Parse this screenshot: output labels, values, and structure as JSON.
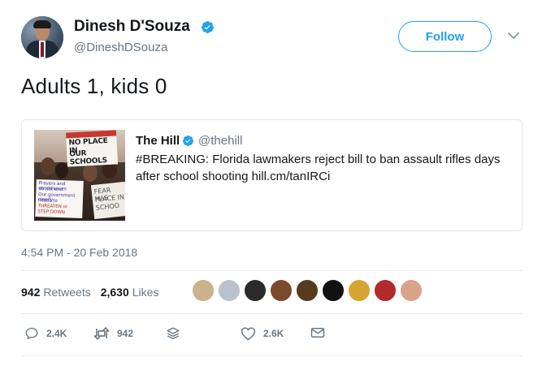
{
  "author": {
    "name": "Dinesh D'Souza",
    "handle": "@DineshDSouza",
    "verified": true
  },
  "follow_label": "Follow",
  "tweet_text": "Adults 1, kids 0",
  "quoted_tweet": {
    "name": "The Hill",
    "handle": "@thehill",
    "verified": true,
    "text": "#BREAKING: Florida lawmakers reject bill to ban assault rifles days after school shooting hill.cm/tanIRCi",
    "image_sign_lines": [
      "NO PLACE IN",
      "OUR SCHOOLS"
    ],
    "image_sign2_lines": [
      "Prayers and condolences",
      "do not end",
      "Our government clearly",
      "needs to",
      "THREATEN or",
      "STEP DOWN"
    ],
    "image_sign3_lines": [
      "FEAR HAS",
      "PLACE IN",
      "SCHOO"
    ]
  },
  "timestamp": "4:54 PM - 20 Feb 2018",
  "stats": {
    "retweets_count": "942",
    "retweets_label": "Retweets",
    "likes_count": "2,630",
    "likes_label": "Likes"
  },
  "likers": [
    {
      "name": "liker-1",
      "color": "#c9b28c"
    },
    {
      "name": "liker-2",
      "color": "#b9c2cc"
    },
    {
      "name": "liker-3",
      "color": "#2a2a2a"
    },
    {
      "name": "liker-4",
      "color": "#7b4a2a"
    },
    {
      "name": "liker-5",
      "color": "#5a3a1e"
    },
    {
      "name": "liker-6",
      "color": "#111111"
    },
    {
      "name": "liker-7",
      "color": "#d7a433"
    },
    {
      "name": "liker-8",
      "color": "#b22a2a"
    },
    {
      "name": "liker-9",
      "color": "#d9a38a"
    }
  ],
  "actions": {
    "reply_count": "2.4K",
    "retweet_count": "942",
    "like_count": "2.6K"
  },
  "colors": {
    "accent": "#1da1f2",
    "secondary_text": "#657786",
    "primary_text": "#14171a",
    "border": "#e1e8ed"
  }
}
